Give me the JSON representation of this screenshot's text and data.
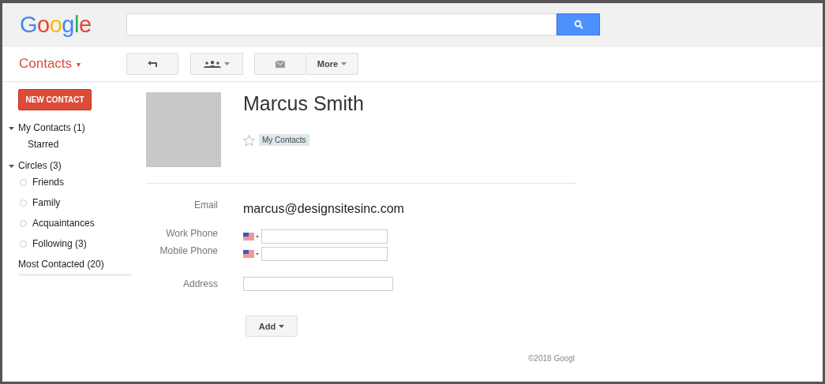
{
  "header": {
    "logo": "Google"
  },
  "app_menu": {
    "label": "Contacts",
    "caret": "▾"
  },
  "toolbar": {
    "more_button": "More"
  },
  "sidebar": {
    "new_contact": "NEW CONTACT",
    "groups": [
      {
        "label": "My Contacts (1)",
        "expanded": true,
        "kind": "plain",
        "children": [
          {
            "label": "Starred"
          }
        ]
      },
      {
        "label": "Circles (3)",
        "expanded": true,
        "kind": "circle",
        "children": [
          {
            "label": "Friends"
          },
          {
            "label": "Family"
          },
          {
            "label": "Acquaintances"
          },
          {
            "label": "Following (3)"
          }
        ]
      }
    ],
    "most_contacted": "Most Contacted (20)"
  },
  "contact": {
    "name": "Marcus Smith",
    "starred": false,
    "tag": "My Contacts",
    "fields": [
      {
        "kind": "text",
        "label": "Email",
        "value": "marcus@designsitesinc.com"
      },
      {
        "kind": "phone",
        "label": "Work Phone"
      },
      {
        "kind": "phone",
        "label": "Mobile Phone"
      },
      {
        "kind": "input",
        "label": "Address"
      }
    ],
    "add_button": "Add"
  },
  "footer": "©2018 Googl"
}
